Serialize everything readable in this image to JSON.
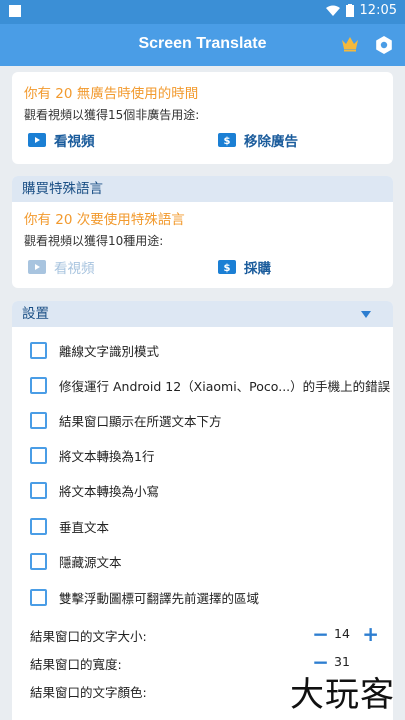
{
  "status": {
    "time": "12:05"
  },
  "appbar": {
    "title": "Screen Translate"
  },
  "card1": {
    "headline": "你有 20 無廣告時使用的時間",
    "subtitle": "觀看視頻以獲得15個非廣告用途:",
    "watch_label": "看視頻",
    "remove_label": "移除廣告"
  },
  "card2": {
    "header": "購買特殊語言",
    "headline": "你有 20 次要使用特殊語言",
    "subtitle": "觀看視頻以獲得10種用途:",
    "watch_label": "看視頻",
    "buy_label": "採購"
  },
  "settings": {
    "header": "設置",
    "options": [
      {
        "label": "離線文字識別模式",
        "checked": false
      },
      {
        "label": "修復運行 Android 12（Xiaomi、Poco...）的手機上的錯誤",
        "checked": false
      },
      {
        "label": "結果窗口顯示在所選文本下方",
        "checked": false
      },
      {
        "label": "將文本轉換為1行",
        "checked": false
      },
      {
        "label": "將文本轉換為小寫",
        "checked": false
      },
      {
        "label": "垂直文本",
        "checked": false
      },
      {
        "label": "隱藏源文本",
        "checked": false
      },
      {
        "label": "雙擊浮動圖標可翻譯先前選擇的區域",
        "checked": false
      }
    ],
    "font_size": {
      "label": "結果窗口的文字大小:",
      "value": "14"
    },
    "width": {
      "label": "結果窗口的寬度:",
      "value": "31"
    },
    "font_color": {
      "label": "結果窗口的文字顏色:"
    }
  },
  "watermark": "大玩客",
  "colors": {
    "accent": "#4a9de6",
    "orange": "#f29a2e",
    "header_bg": "#dde7f3"
  }
}
